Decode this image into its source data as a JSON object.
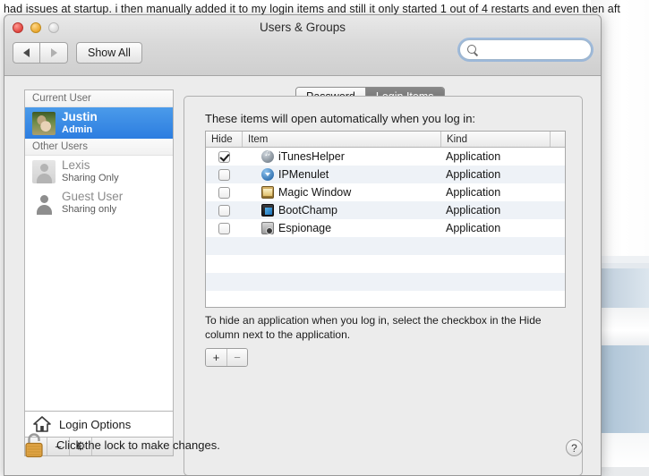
{
  "background": {
    "text": "had issues at startup. i then manually added it to my login items and still it only started 1 out of 4 restarts and even then aft"
  },
  "window": {
    "title": "Users & Groups",
    "traffic_lights": [
      "close",
      "minimize",
      "zoom"
    ],
    "nav": {
      "back_icon": "triangle-left-icon",
      "forward_icon": "triangle-right-icon"
    },
    "show_all_label": "Show All",
    "search": {
      "value": "",
      "placeholder": "",
      "icon": "search-icon"
    }
  },
  "sidebar": {
    "groups": [
      {
        "header": "Current User",
        "users": [
          {
            "name": "Justin",
            "role": "Admin",
            "selected": true,
            "avatar": "rabbit-photo-avatar"
          }
        ]
      },
      {
        "header": "Other Users",
        "users": [
          {
            "name": "Lexis",
            "role": "Sharing Only",
            "selected": false,
            "avatar": "person-silhouette-avatar"
          },
          {
            "name": "Guest User",
            "role": "Sharing only",
            "selected": false,
            "avatar": "person-silhouette-avatar"
          }
        ]
      }
    ],
    "login_options_label": "Login Options",
    "login_options_icon": "home-icon",
    "toolbar": {
      "add": "+",
      "remove": "−",
      "gear": "⚙"
    }
  },
  "tabs": [
    {
      "label": "Password",
      "active": false
    },
    {
      "label": "Login Items",
      "active": true
    }
  ],
  "panel": {
    "title": "These items will open automatically when you log in:",
    "table": {
      "columns": [
        "Hide",
        "Item",
        "Kind"
      ],
      "rows": [
        {
          "hide": true,
          "item": "iTunesHelper",
          "kind": "Application",
          "icon": "itunes-icon"
        },
        {
          "hide": false,
          "item": "IPMenulet",
          "kind": "Application",
          "icon": "ipmenulet-icon"
        },
        {
          "hide": false,
          "item": "Magic Window",
          "kind": "Application",
          "icon": "magic-window-icon"
        },
        {
          "hide": false,
          "item": "BootChamp",
          "kind": "Application",
          "icon": "bootchamp-icon"
        },
        {
          "hide": false,
          "item": "Espionage",
          "kind": "Application",
          "icon": "espionage-icon"
        }
      ]
    },
    "hint": "To hide an application when you log in, select the checkbox in the Hide column next to the application.",
    "add_label": "+",
    "remove_label": "−"
  },
  "footer": {
    "lock_icon": "unlocked-padlock-icon",
    "lock_label": "Click the lock to make changes.",
    "help_label": "?"
  },
  "colors": {
    "selection_blue": "#2c7de0",
    "active_tab_gray": "#6e6e6e",
    "row_stripe": "#eef2f7",
    "window_chrome": "#ececec",
    "lock_gold": "#e0a445"
  }
}
